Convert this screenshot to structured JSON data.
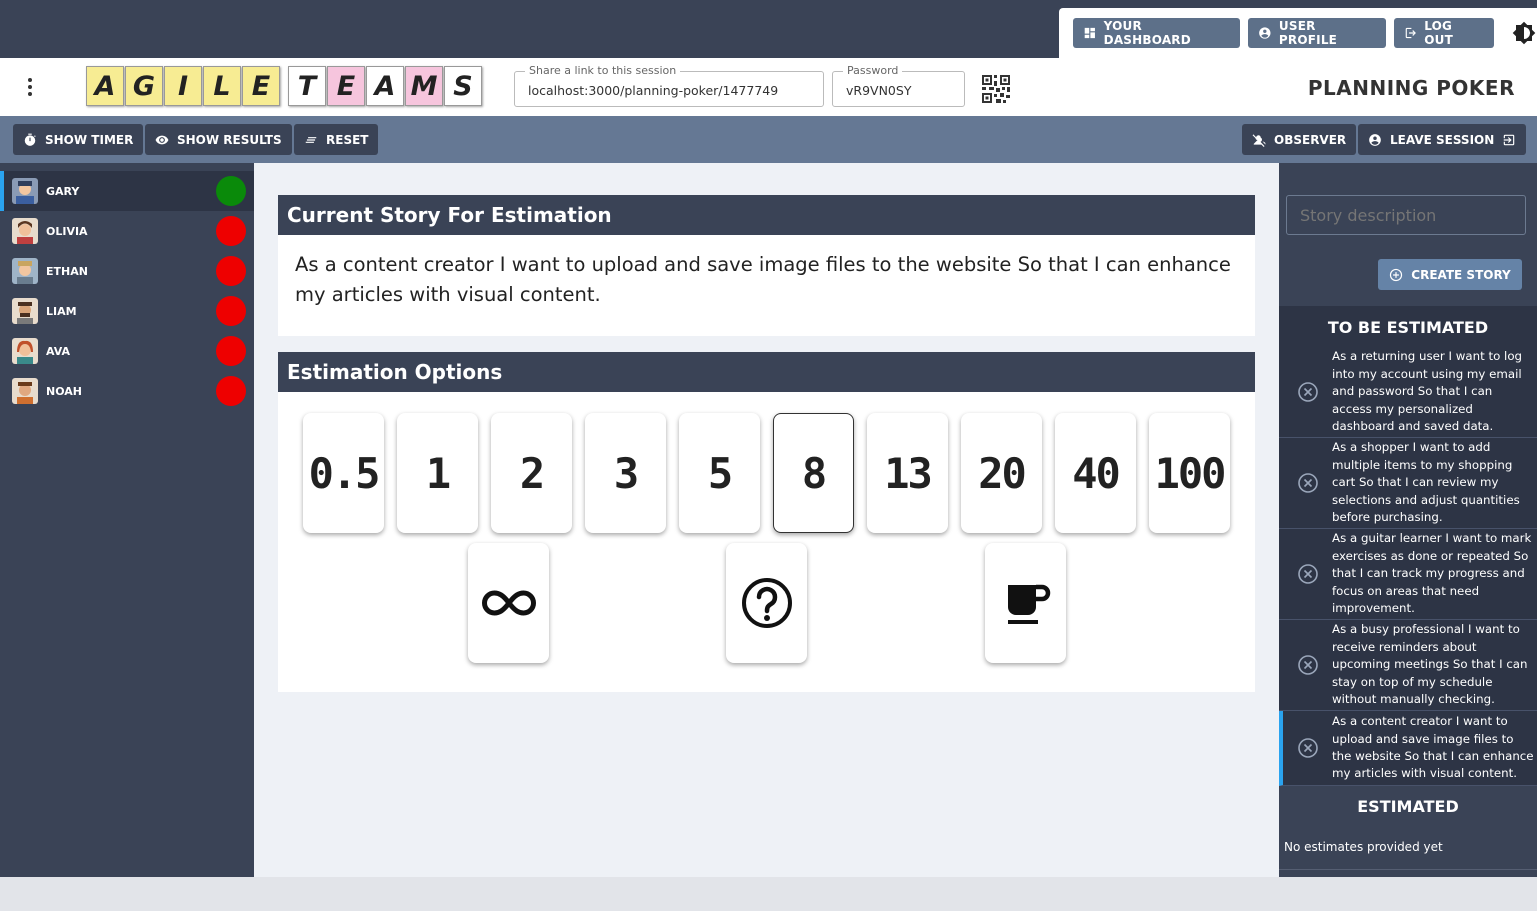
{
  "nav": {
    "dashboard": "YOUR DASHBOARD",
    "profile": "USER PROFILE",
    "logout": "LOG OUT"
  },
  "header": {
    "logo_letters": [
      "A",
      "G",
      "I",
      "L",
      "E",
      "T",
      "E",
      "A",
      "M",
      "S"
    ],
    "share_label": "Share a link to this session",
    "share_value": "localhost:3000/planning-poker/1477749",
    "password_label": "Password",
    "password_value": "vR9VN0SY",
    "title": "PLANNING POKER"
  },
  "toolbar": {
    "show_timer": "SHOW TIMER",
    "show_results": "SHOW RESULTS",
    "reset": "RESET",
    "observer": "OBSERVER",
    "leave": "LEAVE SESSION"
  },
  "players": [
    {
      "name": "GARY",
      "status": "voted",
      "color": "#0a8a0a"
    },
    {
      "name": "OLIVIA",
      "status": "not-voted",
      "color": "#ee0000"
    },
    {
      "name": "ETHAN",
      "status": "not-voted",
      "color": "#ee0000"
    },
    {
      "name": "LIAM",
      "status": "not-voted",
      "color": "#ee0000"
    },
    {
      "name": "AVA",
      "status": "not-voted",
      "color": "#ee0000"
    },
    {
      "name": "NOAH",
      "status": "not-voted",
      "color": "#ee0000"
    }
  ],
  "current_story": {
    "heading": "Current Story For Estimation",
    "text": "As a content creator I want to upload and save image files to the website So that I can enhance my articles with visual content."
  },
  "estimation": {
    "heading": "Estimation Options",
    "cards": [
      "0.5",
      "1",
      "2",
      "3",
      "5",
      "8",
      "13",
      "20",
      "40",
      "100"
    ],
    "selected": "8",
    "special": [
      "infinity-icon",
      "question-icon",
      "coffee-icon"
    ]
  },
  "stories": {
    "input_placeholder": "Story description",
    "create_label": "CREATE STORY",
    "to_be_estimated_heading": "TO BE ESTIMATED",
    "items": [
      "As a returning user I want to log into my account using my email and password So that I can access my personalized dashboard and saved data.",
      "As a shopper I want to add multiple items to my shopping cart So that I can review my selections and adjust quantities before purchasing.",
      "As a guitar learner I want to mark exercises as done or repeated So that I can track my progress and focus on areas that need improvement.",
      "As a busy professional I want to receive reminders about upcoming meetings So that I can stay on top of my schedule without manually checking.",
      "As a content creator I want to upload and save image files to the website So that I can enhance my articles with visual content."
    ],
    "estimated_heading": "ESTIMATED",
    "no_estimates": "No estimates provided yet"
  }
}
